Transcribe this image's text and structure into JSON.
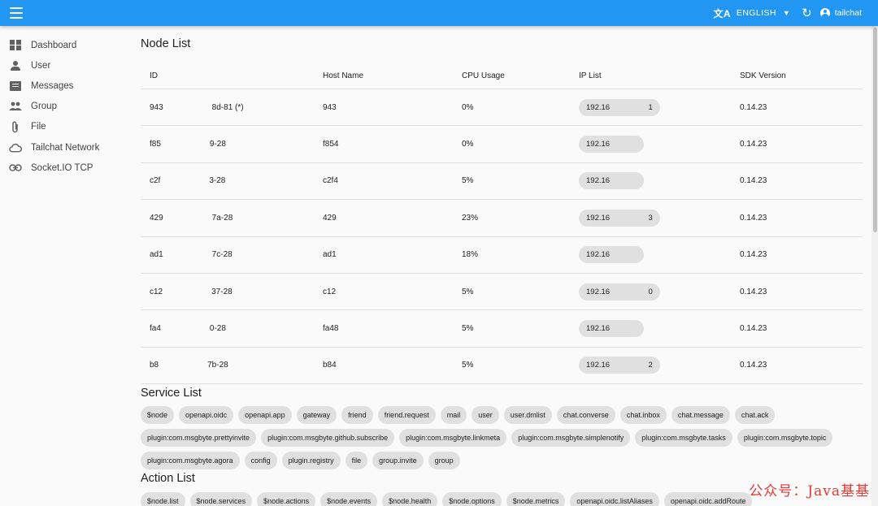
{
  "topbar": {
    "language": "ENGLISH",
    "username": "tailchat"
  },
  "sidebar": {
    "items": [
      {
        "label": "Dashboard",
        "icon": "dashboard-icon"
      },
      {
        "label": "User",
        "icon": "user-icon"
      },
      {
        "label": "Messages",
        "icon": "messages-icon"
      },
      {
        "label": "Group",
        "icon": "group-icon"
      },
      {
        "label": "File",
        "icon": "attach-file-icon"
      },
      {
        "label": "Tailchat Network",
        "icon": "cloud-icon"
      },
      {
        "label": "Socket.IO TCP",
        "icon": "link-icon"
      }
    ]
  },
  "node_list": {
    "title": "Node List",
    "columns": [
      "ID",
      "Host Name",
      "CPU Usage",
      "IP List",
      "SDK Version"
    ],
    "rows": [
      {
        "id": "943      8d-81 (*)",
        "host": "943",
        "cpu": "0%",
        "ip": "192.16     1",
        "sdk": "0.14.23"
      },
      {
        "id": "f85      9-28",
        "host": "f854",
        "cpu": "0%",
        "ip": "192.16",
        "sdk": "0.14.23"
      },
      {
        "id": "c2f      3-28",
        "host": "c2f4",
        "cpu": "5%",
        "ip": "192.16",
        "sdk": "0.14.23"
      },
      {
        "id": "429      7a-28",
        "host": "429",
        "cpu": "23%",
        "ip": "192.16     3",
        "sdk": "0.14.23"
      },
      {
        "id": "ad1      7c-28",
        "host": "ad1",
        "cpu": "18%",
        "ip": "192.16",
        "sdk": "0.14.23"
      },
      {
        "id": "c12      37-28",
        "host": "c12",
        "cpu": "5%",
        "ip": "192.16     0",
        "sdk": "0.14.23"
      },
      {
        "id": "fa4      0-28",
        "host": "fa48",
        "cpu": "5%",
        "ip": "192.16",
        "sdk": "0.14.23"
      },
      {
        "id": "b8      7b-28",
        "host": "b84",
        "cpu": "5%",
        "ip": "192.16     2",
        "sdk": "0.14.23"
      }
    ]
  },
  "service_list": {
    "title": "Service List",
    "items": [
      "$node",
      "openapi.oidc",
      "openapi.app",
      "gateway",
      "friend",
      "friend.request",
      "mail",
      "user",
      "user.dmlist",
      "chat.converse",
      "chat.inbox",
      "chat.message",
      "chat.ack",
      "plugin:com.msgbyte.prettyinvite",
      "plugin:com.msgbyte.github.subscribe",
      "plugin:com.msgbyte.linkmeta",
      "plugin:com.msgbyte.simplenotify",
      "plugin:com.msgbyte.tasks",
      "plugin:com.msgbyte.topic",
      "plugin:com.msgbyte.agora",
      "config",
      "plugin.registry",
      "file",
      "group.invite",
      "group"
    ]
  },
  "action_list": {
    "title": "Action List",
    "items": [
      "$node.list",
      "$node.services",
      "$node.actions",
      "$node.events",
      "$node.health",
      "$node.options",
      "$node.metrics",
      "openapi.oidc.listAliases",
      "openapi.oidc.addRoute"
    ]
  },
  "watermark": "公众号：Java基基",
  "colors": {
    "appbar": "#2196f3",
    "chip": "#e0e0e0",
    "watermark": "#e53935"
  }
}
